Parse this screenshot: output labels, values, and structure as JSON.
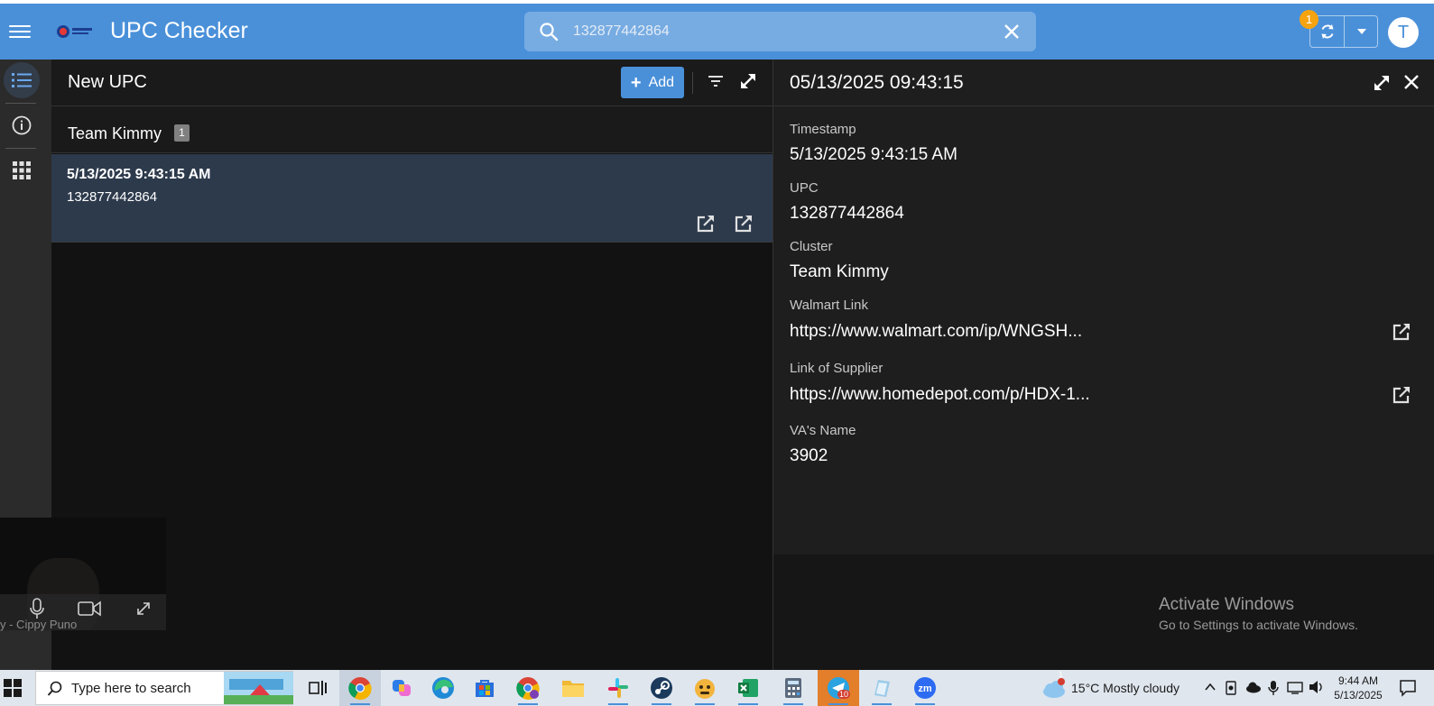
{
  "topbar": {
    "title": "UPC Checker",
    "search_value": "132877442864",
    "sync_badge": "1",
    "avatar_initial": "T",
    "color": "#4a90d9"
  },
  "list": {
    "title": "New UPC",
    "add_label": "Add",
    "group": {
      "name": "Team Kimmy",
      "count": "1"
    },
    "rows": [
      {
        "timestamp": "5/13/2025 9:43:15 AM",
        "upc": "132877442864"
      }
    ]
  },
  "detail": {
    "title": "05/13/2025 09:43:15",
    "fields": [
      {
        "label": "Timestamp",
        "value": "5/13/2025 9:43:15 AM"
      },
      {
        "label": "UPC",
        "value": "132877442864"
      },
      {
        "label": "Cluster",
        "value": "Team Kimmy"
      },
      {
        "label": "Walmart Link",
        "value": "https://www.walmart.com/ip/WNGSH..."
      },
      {
        "label": "Link of Supplier",
        "value": "https://www.homedepot.com/p/HDX-1..."
      },
      {
        "label": "VA's Name",
        "value": "3902"
      }
    ]
  },
  "watermark": {
    "line1": "Activate Windows",
    "line2": "Go to Settings to activate Windows."
  },
  "video": {
    "name": "y - Cippy Puno"
  },
  "taskbar": {
    "search_placeholder": "Type here to search",
    "weather": "15°C  Mostly cloudy",
    "weather_badge": "1",
    "telegram_badge": "10",
    "time": "9:44 AM",
    "date": "5/13/2025",
    "apps": [
      "task-view",
      "chrome",
      "copilot",
      "edge",
      "store",
      "chrome-profile",
      "file-explorer",
      "slack",
      "steam",
      "game",
      "excel",
      "calculator",
      "telegram",
      "notes",
      "zoom"
    ]
  }
}
